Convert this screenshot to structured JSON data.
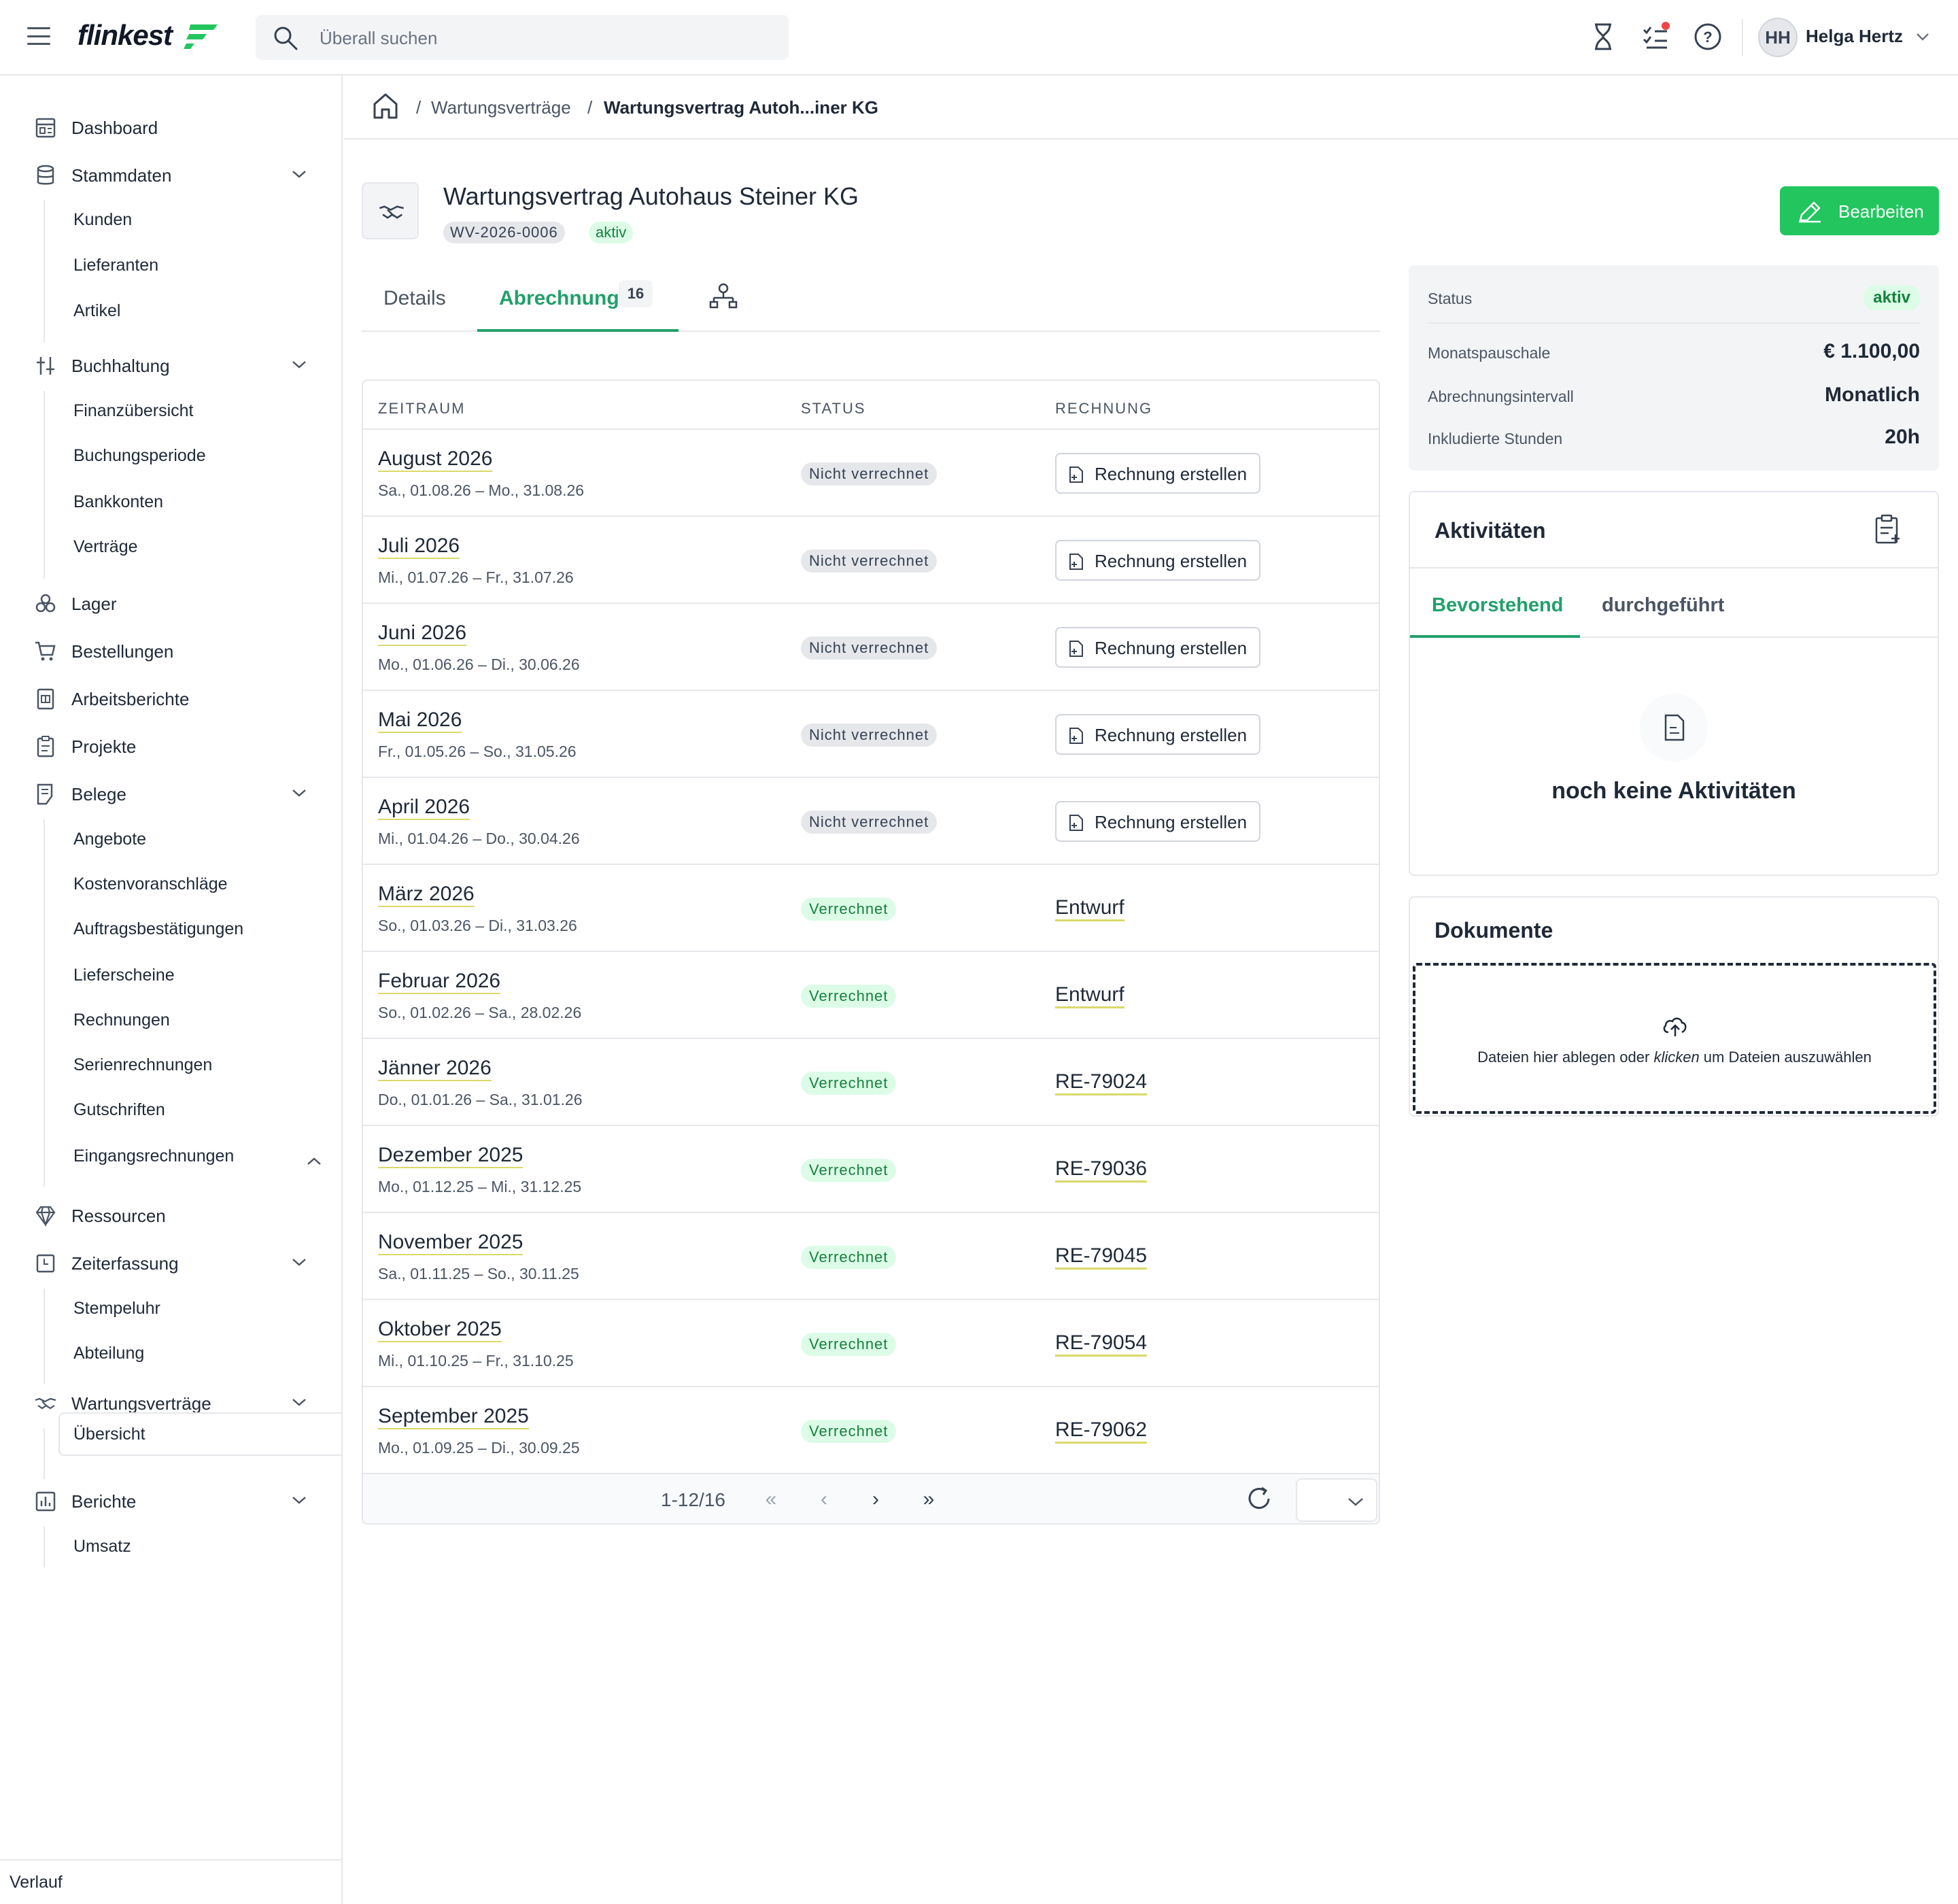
{
  "app": {
    "logo": "flinkest",
    "search_placeholder": "Überall suchen",
    "user_initials": "HH",
    "user_name": "Helga Hertz",
    "accent_color": "#22c55e"
  },
  "sidebar": {
    "items": [
      {
        "label": "Dashboard",
        "icon": "dashboard-icon"
      },
      {
        "label": "Stammdaten",
        "icon": "database-icon"
      },
      {
        "label": "Kunden"
      },
      {
        "label": "Lieferanten"
      },
      {
        "label": "Artikel"
      },
      {
        "label": "Buchhaltung",
        "icon": "sliders-icon"
      },
      {
        "label": "Finanzübersicht"
      },
      {
        "label": "Buchungsperiode"
      },
      {
        "label": "Bankkonten"
      },
      {
        "label": "Verträge"
      },
      {
        "label": "Lager",
        "icon": "boxes-icon"
      },
      {
        "label": "Bestellungen",
        "icon": "cart-icon"
      },
      {
        "label": "Arbeitsberichte",
        "icon": "report-icon"
      },
      {
        "label": "Projekte",
        "icon": "clipboard-icon"
      },
      {
        "label": "Belege",
        "icon": "receipt-icon"
      },
      {
        "label": "Angebote"
      },
      {
        "label": "Kostenvoranschläge"
      },
      {
        "label": "Auftragsbestätigungen"
      },
      {
        "label": "Lieferscheine"
      },
      {
        "label": "Rechnungen"
      },
      {
        "label": "Serienrechnungen"
      },
      {
        "label": "Gutschriften"
      },
      {
        "label": "Eingangsrechnungen"
      },
      {
        "label": "Ressourcen",
        "icon": "diamond-icon"
      },
      {
        "label": "Zeiterfassung",
        "icon": "clock-icon"
      },
      {
        "label": "Stempeluhr"
      },
      {
        "label": "Abteilung"
      },
      {
        "label": "Wartungsverträge",
        "icon": "handshake-icon"
      },
      {
        "label": "Übersicht"
      },
      {
        "label": "Berichte",
        "icon": "chart-icon"
      },
      {
        "label": "Umsatz"
      }
    ],
    "footer": "Verlauf"
  },
  "breadcrumb": {
    "sep": "/",
    "level1": "Wartungsverträge",
    "level2": "Wartungsvertrag Autoh...iner KG"
  },
  "header": {
    "title": "Wartungsvertrag Autohaus Steiner KG",
    "number": "WV-2026-0006",
    "status": "aktiv",
    "edit_label": "Bearbeiten"
  },
  "tabs": {
    "details": "Details",
    "abrechnung": "Abrechnung",
    "abrechnung_count": "16"
  },
  "table": {
    "headers": {
      "period": "ZEITRAUM",
      "status": "STATUS",
      "invoice": "RECHNUNG"
    },
    "rows": [
      {
        "period": "August 2026",
        "range": "Sa., 01.08.26 – Mo., 31.08.26",
        "status": "Nicht verrechnet",
        "invoice": "Rechnung erstellen"
      },
      {
        "period": "Juli 2026",
        "range": "Mi., 01.07.26 – Fr., 31.07.26",
        "status": "Nicht verrechnet",
        "invoice": "Rechnung erstellen"
      },
      {
        "period": "Juni 2026",
        "range": "Mo., 01.06.26 – Di., 30.06.26",
        "status": "Nicht verrechnet",
        "invoice": "Rechnung erstellen"
      },
      {
        "period": "Mai 2026",
        "range": "Fr., 01.05.26 – So., 31.05.26",
        "status": "Nicht verrechnet",
        "invoice": "Rechnung erstellen"
      },
      {
        "period": "April 2026",
        "range": "Mi., 01.04.26 – Do., 30.04.26",
        "status": "Nicht verrechnet",
        "invoice": "Rechnung erstellen"
      },
      {
        "period": "März 2026",
        "range": "So., 01.03.26 – Di., 31.03.26",
        "status": "Verrechnet",
        "invoice": "Entwurf"
      },
      {
        "period": "Februar 2026",
        "range": "So., 01.02.26 – Sa., 28.02.26",
        "status": "Verrechnet",
        "invoice": "Entwurf"
      },
      {
        "period": "Jänner 2026",
        "range": "Do., 01.01.26 – Sa., 31.01.26",
        "status": "Verrechnet",
        "invoice": "RE-79024"
      },
      {
        "period": "Dezember 2025",
        "range": "Mo., 01.12.25 – Mi., 31.12.25",
        "status": "Verrechnet",
        "invoice": "RE-79036"
      },
      {
        "period": "November 2025",
        "range": "Sa., 01.11.25 – So., 30.11.25",
        "status": "Verrechnet",
        "invoice": "RE-79045"
      },
      {
        "period": "Oktober 2025",
        "range": "Mi., 01.10.25 – Fr., 31.10.25",
        "status": "Verrechnet",
        "invoice": "RE-79054"
      },
      {
        "period": "September 2025",
        "range": "Mo., 01.09.25 – Di., 30.09.25",
        "status": "Verrechnet",
        "invoice": "RE-79062"
      }
    ],
    "pagination": "1-12/16",
    "first": "«",
    "prev": "‹",
    "next": "›",
    "last": "»"
  },
  "summary": {
    "status_label": "Status",
    "status_value": "aktiv",
    "fee_label": "Monatspauschale",
    "fee_value": "€ 1.100,00",
    "interval_label": "Abrechnungsintervall",
    "interval_value": "Monatlich",
    "hours_label": "Inkludierte Stunden",
    "hours_value": "20h"
  },
  "activities": {
    "title": "Aktivitäten",
    "tab_upcoming": "Bevorstehend",
    "tab_done": "durchgeführt",
    "empty": "noch keine Aktivitäten"
  },
  "documents": {
    "title": "Dokumente",
    "drop_before": "Dateien hier ablegen oder ",
    "drop_em": "klicken",
    "drop_after": " um Dateien auszuwählen"
  }
}
